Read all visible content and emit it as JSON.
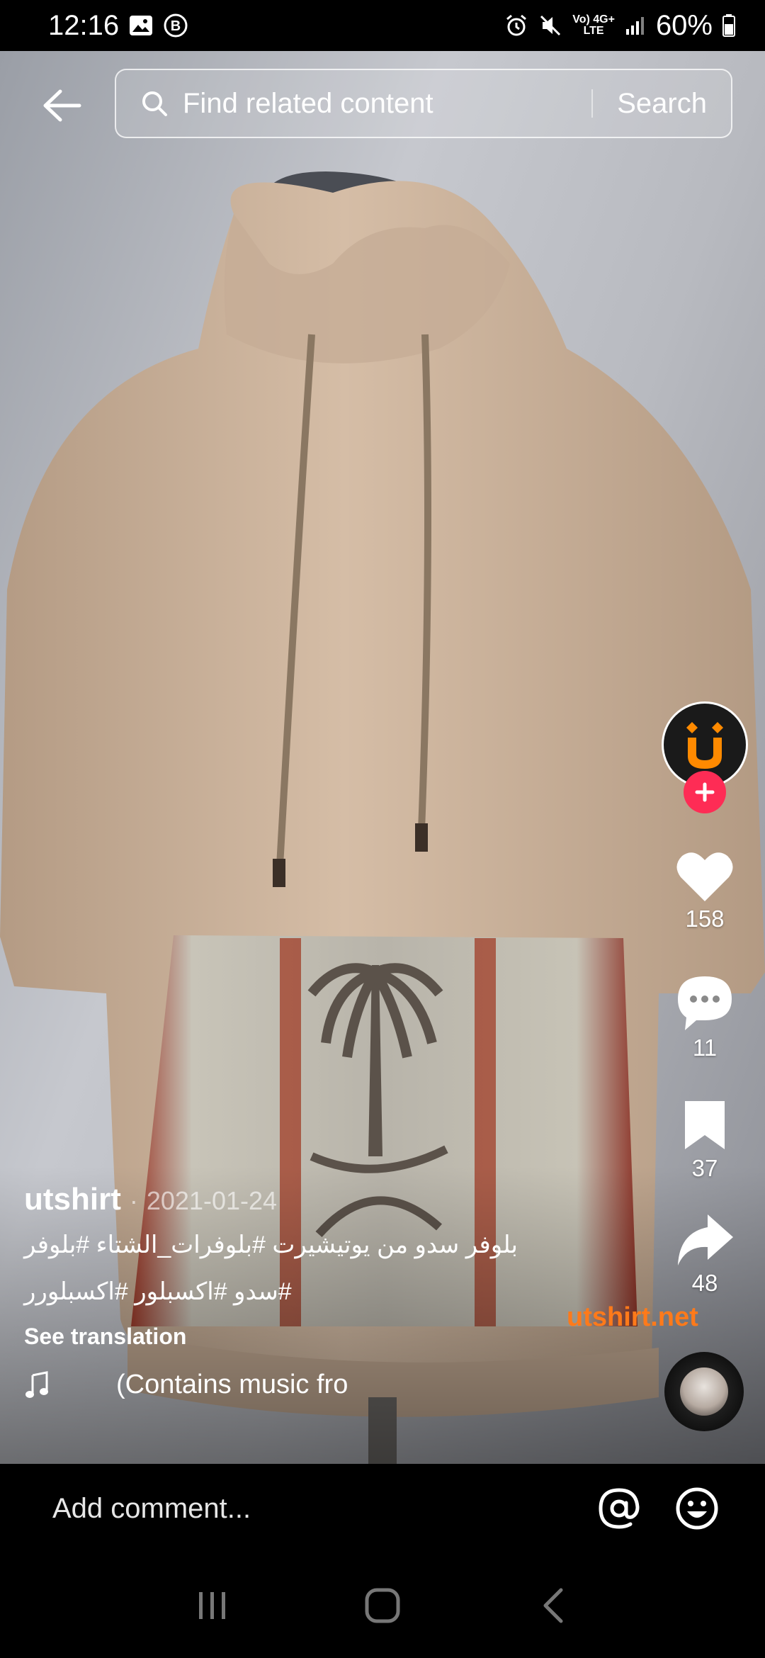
{
  "status_bar": {
    "time": "12:16",
    "battery": "60%",
    "network_top": "Vo) 4G+",
    "network_bottom": "LTE"
  },
  "search": {
    "placeholder": "Find related content",
    "button_label": "Search"
  },
  "actions": {
    "likes": "158",
    "comments": "11",
    "saves": "37",
    "shares": "48"
  },
  "caption": {
    "username": "utshirt",
    "separator": "·",
    "date": "2021-01-24",
    "description_line1": "بلوفر سدو من يوتيشيرت #بلوفرات_الشتاء #بلوفر",
    "description_line2": "#سدو #اكسبلور #اكسبلورر",
    "see_translation": "See translation",
    "music": "(Contains music fro"
  },
  "watermark": "utshirt.net",
  "comment_bar": {
    "placeholder": "Add comment..."
  },
  "colors": {
    "accent": "#fe2c55",
    "watermark": "#ff7a1a",
    "logo": "#ff8a00"
  }
}
